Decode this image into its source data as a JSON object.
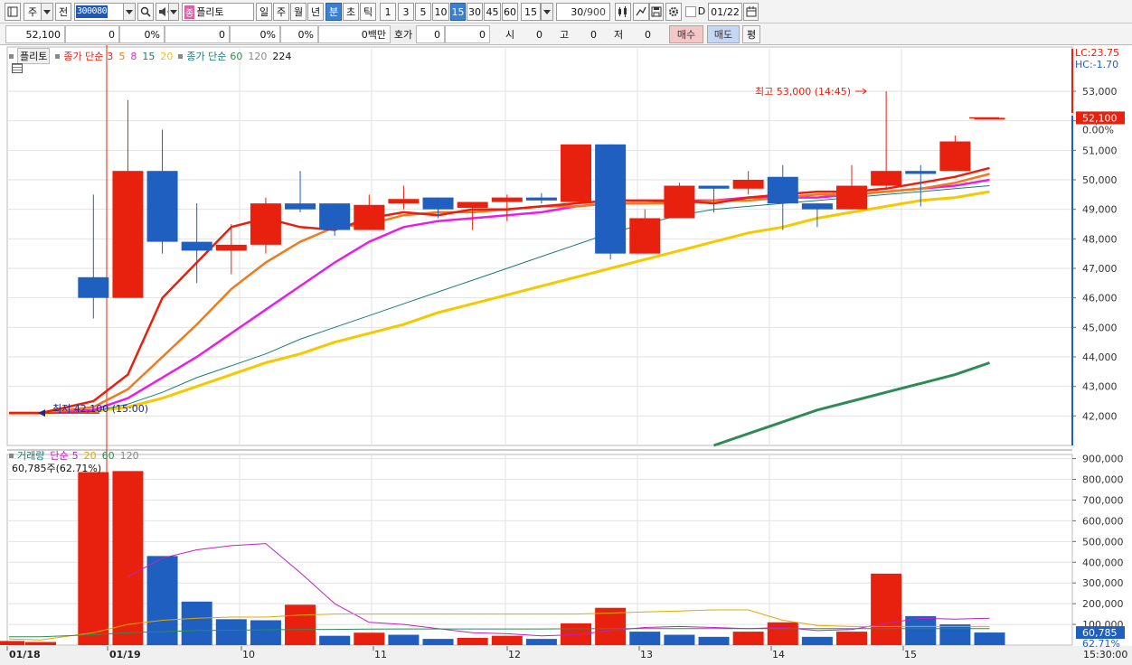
{
  "toolbar": {
    "market_label": "주",
    "prev_label": "전",
    "stock_code": "300080",
    "stock_name": "플리토",
    "stock_badge": "종",
    "periods": [
      "일",
      "주",
      "월",
      "년",
      "분",
      "초",
      "틱"
    ],
    "active_period": "분",
    "intervals": [
      "1",
      "3",
      "5",
      "10",
      "15",
      "30",
      "45",
      "60"
    ],
    "active_interval": "15",
    "interval_value": "15",
    "count_value": "30",
    "count_total": "/900",
    "d_label": "D",
    "date_value": "01/22"
  },
  "quote": {
    "price": "52,100",
    "change": "0",
    "rate": "0%",
    "v1": "0",
    "v1_rate": "0%",
    "v2": "0",
    "v2_rate": "0%",
    "volume_unit": "0백만",
    "hoga_label": "호가",
    "hoga1": "0",
    "hoga2": "0",
    "open_label": "시",
    "open_val": "0",
    "high_label": "고",
    "high_val": "0",
    "low_label": "저",
    "low_val": "0",
    "buy_label": "매수",
    "sell_label": "매도",
    "pyeong_label": "평"
  },
  "price_legend": {
    "name": "플리토",
    "ma1_label": "종가 단순",
    "ma1_periods": [
      "3",
      "5",
      "8",
      "15",
      "20"
    ],
    "ma2_label": "종가 단순",
    "ma2_periods": [
      "60",
      "120",
      "224"
    ]
  },
  "volume_legend": {
    "name": "거래량",
    "ma_label": "단순",
    "ma_periods": [
      "5",
      "20",
      "60",
      "120"
    ],
    "current": "60,785주(62.71%)"
  },
  "annotations": {
    "high": "최고 53,000 (14:45)",
    "low": "최저 42,100 (15:00)",
    "lc": "LC:23.75",
    "hc": "HC:-1.70",
    "last_price": "52,100",
    "zero_pct": "0.00%",
    "last_volume": "60,785",
    "last_volume_pct": "62.71%",
    "time_label": "15:30:00"
  },
  "colors": {
    "up": "#e8200e",
    "down": "#1f5fbf",
    "ma3": "#e8200e",
    "ma5": "#f07a1a",
    "ma8": "#e81ee8",
    "ma15": "#1a7a7a",
    "ma20": "#f5c800",
    "ma60": "#2e8b57",
    "grid": "#e2e2e2"
  },
  "chart_data": [
    {
      "type": "candlestick",
      "title": "플리토",
      "ylim": [
        41000,
        54500
      ],
      "y_ticks": [
        "42,000",
        "43,000",
        "44,000",
        "45,000",
        "46,000",
        "47,000",
        "48,000",
        "49,000",
        "50,000",
        "51,000",
        "52,000",
        "53,000"
      ],
      "x_labels": [
        "01/18",
        "01/19",
        "10",
        "11",
        "12",
        "13",
        "14",
        "15"
      ],
      "candles": [
        {
          "o": 42100,
          "h": 42100,
          "l": 42100,
          "c": 42100
        },
        {
          "o": 42100,
          "h": 42100,
          "l": 42100,
          "c": 42100
        },
        {
          "o": 46700,
          "h": 49500,
          "l": 45300,
          "c": 46000
        },
        {
          "o": 46000,
          "h": 52700,
          "l": 46000,
          "c": 50300
        },
        {
          "o": 50300,
          "h": 51700,
          "l": 47500,
          "c": 47900
        },
        {
          "o": 47900,
          "h": 49200,
          "l": 46500,
          "c": 47600
        },
        {
          "o": 47600,
          "h": 48500,
          "l": 46800,
          "c": 47800
        },
        {
          "o": 47800,
          "h": 49400,
          "l": 47500,
          "c": 49200
        },
        {
          "o": 49200,
          "h": 50300,
          "l": 48900,
          "c": 49000
        },
        {
          "o": 49200,
          "h": 49200,
          "l": 48100,
          "c": 48300
        },
        {
          "o": 48300,
          "h": 49500,
          "l": 48300,
          "c": 49150
        },
        {
          "o": 49200,
          "h": 49800,
          "l": 49000,
          "c": 49350
        },
        {
          "o": 49400,
          "h": 49400,
          "l": 48700,
          "c": 49000
        },
        {
          "o": 49050,
          "h": 49250,
          "l": 48300,
          "c": 49250
        },
        {
          "o": 49250,
          "h": 49500,
          "l": 48600,
          "c": 49400
        },
        {
          "o": 49400,
          "h": 49550,
          "l": 49200,
          "c": 49300
        },
        {
          "o": 49250,
          "h": 51200,
          "l": 49250,
          "c": 51200
        },
        {
          "o": 51200,
          "h": 51200,
          "l": 47300,
          "c": 47500
        },
        {
          "o": 47500,
          "h": 49000,
          "l": 47500,
          "c": 48700
        },
        {
          "o": 48700,
          "h": 49900,
          "l": 48700,
          "c": 49800
        },
        {
          "o": 49800,
          "h": 49800,
          "l": 48900,
          "c": 49700
        },
        {
          "o": 49700,
          "h": 50300,
          "l": 49500,
          "c": 50000
        },
        {
          "o": 50100,
          "h": 50500,
          "l": 48300,
          "c": 49200
        },
        {
          "o": 49200,
          "h": 49200,
          "l": 48400,
          "c": 49000
        },
        {
          "o": 49000,
          "h": 50500,
          "l": 49000,
          "c": 49800
        },
        {
          "o": 49800,
          "h": 53000,
          "l": 49700,
          "c": 50300
        },
        {
          "o": 50300,
          "h": 50500,
          "l": 49100,
          "c": 50200
        },
        {
          "o": 50300,
          "h": 51500,
          "l": 50300,
          "c": 51300
        },
        {
          "o": 52100,
          "h": 52100,
          "l": 52100,
          "c": 52100
        }
      ],
      "series": [
        {
          "name": "3",
          "values": [
            42100,
            42100,
            42500,
            43400,
            46000,
            47200,
            48400,
            48700,
            48400,
            48300,
            48700,
            48900,
            48800,
            49000,
            49000,
            49100,
            49200,
            49300,
            49300,
            49300,
            49200,
            49400,
            49500,
            49600,
            49600,
            49700,
            49900,
            50100,
            50400
          ]
        },
        {
          "name": "5",
          "values": [
            42100,
            42100,
            42300,
            42900,
            44000,
            45100,
            46300,
            47200,
            47900,
            48400,
            48500,
            48800,
            48900,
            48900,
            49000,
            49100,
            49100,
            49200,
            49200,
            49200,
            49300,
            49300,
            49400,
            49500,
            49500,
            49600,
            49700,
            49900,
            50200
          ]
        },
        {
          "name": "8",
          "values": [
            42100,
            42100,
            42200,
            42600,
            43300,
            44000,
            44800,
            45600,
            46400,
            47200,
            47900,
            48400,
            48600,
            48700,
            48800,
            48900,
            49100,
            49200,
            49200,
            49300,
            49300,
            49400,
            49400,
            49400,
            49500,
            49600,
            49700,
            49800,
            50000
          ]
        },
        {
          "name": "15",
          "values": [
            42100,
            42100,
            42150,
            42400,
            42800,
            43300,
            43700,
            44100,
            44600,
            45000,
            45400,
            45800,
            46200,
            46600,
            47000,
            47400,
            47800,
            48200,
            48500,
            48800,
            49000,
            49100,
            49200,
            49300,
            49400,
            49500,
            49600,
            49700,
            49800
          ]
        },
        {
          "name": "20",
          "values": [
            42100,
            42100,
            42150,
            42300,
            42600,
            43000,
            43400,
            43800,
            44100,
            44500,
            44800,
            45100,
            45500,
            45800,
            46100,
            46400,
            46700,
            47000,
            47300,
            47600,
            47900,
            48200,
            48400,
            48700,
            48900,
            49100,
            49300,
            49400,
            49600
          ]
        },
        {
          "name": "60",
          "values": [
            null,
            null,
            null,
            null,
            null,
            null,
            null,
            null,
            null,
            null,
            null,
            null,
            null,
            null,
            null,
            null,
            null,
            null,
            null,
            null,
            41000,
            41400,
            41800,
            42200,
            42500,
            42800,
            43100,
            43400,
            43800
          ]
        }
      ]
    },
    {
      "type": "bar",
      "title": "거래량",
      "ylim": [
        0,
        920000
      ],
      "y_ticks": [
        "100,000",
        "200,000",
        "300,000",
        "400,000",
        "500,000",
        "600,000",
        "700,000",
        "800,000",
        "900,000"
      ],
      "values": [
        20000,
        15000,
        835000,
        840000,
        430000,
        210000,
        125000,
        120000,
        195000,
        45000,
        60000,
        50000,
        30000,
        35000,
        45000,
        30000,
        105000,
        180000,
        65000,
        50000,
        40000,
        65000,
        110000,
        40000,
        65000,
        345000,
        140000,
        100000,
        60785
      ],
      "up": [
        true,
        true,
        true,
        true,
        false,
        false,
        false,
        false,
        true,
        false,
        true,
        false,
        false,
        true,
        true,
        false,
        true,
        true,
        false,
        false,
        false,
        true,
        true,
        false,
        true,
        true,
        false,
        false,
        false
      ],
      "series": [
        {
          "name": "5",
          "values": [
            null,
            null,
            null,
            330000,
            420000,
            460000,
            480000,
            490000,
            350000,
            200000,
            110000,
            100000,
            80000,
            60000,
            55000,
            45000,
            50000,
            70000,
            85000,
            90000,
            85000,
            80000,
            85000,
            70000,
            75000,
            105000,
            130000,
            125000,
            130000
          ]
        },
        {
          "name": "20",
          "values": [
            30000,
            25000,
            60000,
            100000,
            120000,
            130000,
            135000,
            135000,
            145000,
            150000,
            150000,
            150000,
            150000,
            150000,
            150000,
            150000,
            150000,
            155000,
            160000,
            165000,
            170000,
            170000,
            120000,
            95000,
            90000,
            90000,
            90000,
            90000,
            90000
          ]
        },
        {
          "name": "60",
          "values": [
            40000,
            40000,
            50000,
            60000,
            65000,
            70000,
            72000,
            74000,
            75000,
            76000,
            77000,
            78000,
            78000,
            78000,
            78000,
            78000,
            79000,
            80000,
            80000,
            80000,
            80000,
            80000,
            80000,
            80000,
            80000,
            80000,
            80000,
            80000,
            80000
          ]
        }
      ]
    }
  ]
}
